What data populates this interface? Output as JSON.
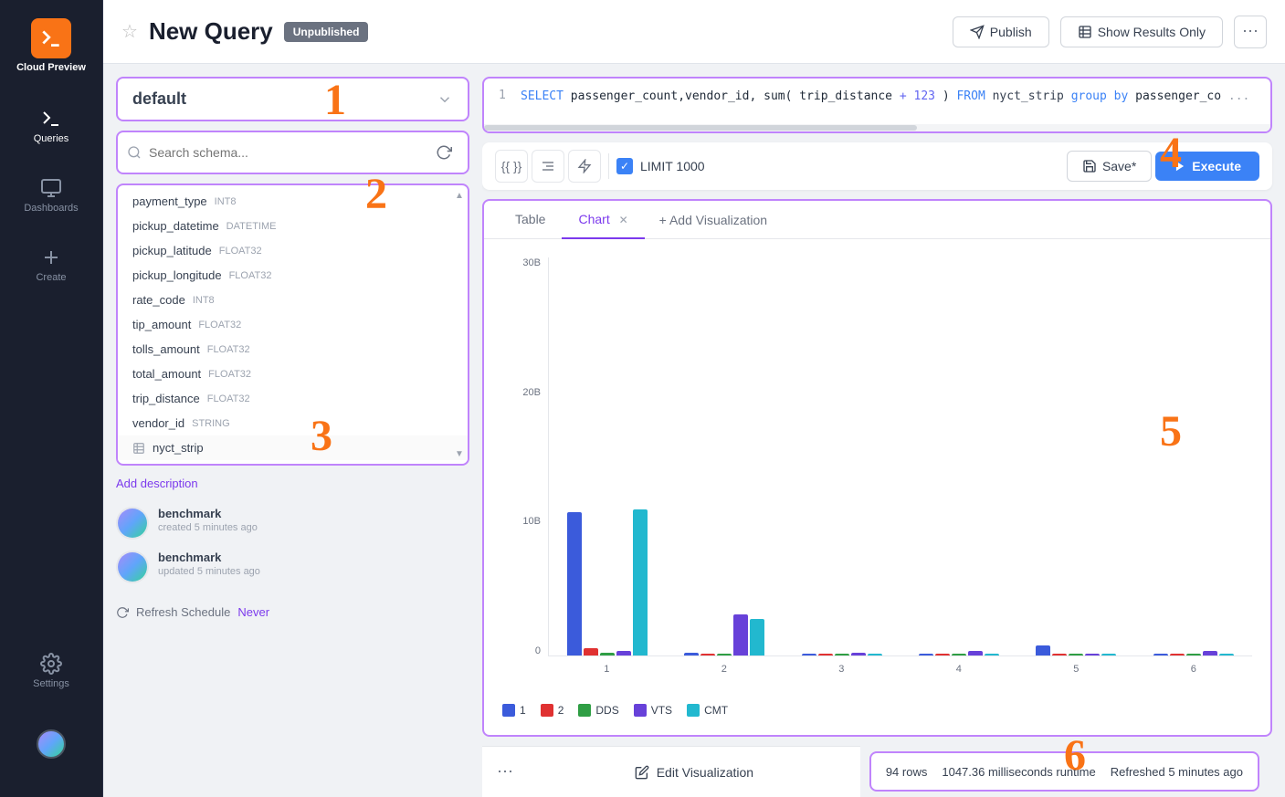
{
  "app": {
    "title": "Cloud Preview",
    "logo_icon": "terminal"
  },
  "sidebar": {
    "items": [
      {
        "label": "Queries",
        "icon": "terminal-icon",
        "active": true
      },
      {
        "label": "Dashboards",
        "icon": "monitor-icon",
        "active": false
      },
      {
        "label": "Create",
        "icon": "plus-icon",
        "active": false
      },
      {
        "label": "Settings",
        "icon": "gear-icon",
        "active": false
      }
    ]
  },
  "header": {
    "title": "New Query",
    "badge": "Unpublished",
    "publish_label": "Publish",
    "show_results_label": "Show Results Only",
    "more_icon": "ellipsis"
  },
  "schema": {
    "selected": "default",
    "search_placeholder": "Search schema...",
    "items": [
      {
        "name": "payment_type",
        "type": "INT8"
      },
      {
        "name": "pickup_datetime",
        "type": "DATETIME"
      },
      {
        "name": "pickup_latitude",
        "type": "FLOAT32"
      },
      {
        "name": "pickup_longitude",
        "type": "FLOAT32"
      },
      {
        "name": "rate_code",
        "type": "INT8"
      },
      {
        "name": "tip_amount",
        "type": "FLOAT32"
      },
      {
        "name": "tolls_amount",
        "type": "FLOAT32"
      },
      {
        "name": "total_amount",
        "type": "FLOAT32"
      },
      {
        "name": "trip_distance",
        "type": "FLOAT32"
      },
      {
        "name": "vendor_id",
        "type": "STRING"
      }
    ],
    "table": "nyct_strip",
    "add_desc_label": "Add description"
  },
  "query": {
    "line1": "SELECT passenger_count,vendor_id,sum(trip_distance+123) FROM nyct_strip group by passenger_co..."
  },
  "toolbar": {
    "template_label": "{{ }}",
    "indent_label": "indent",
    "lightning_label": "lightning",
    "limit_label": "LIMIT 1000",
    "limit_checked": true,
    "save_label": "Save*",
    "execute_label": "Execute"
  },
  "results": {
    "tabs": [
      {
        "label": "Table",
        "active": false,
        "closable": false
      },
      {
        "label": "Chart",
        "active": true,
        "closable": true
      }
    ],
    "add_viz_label": "+ Add Visualization",
    "chart": {
      "yaxis_labels": [
        "30B",
        "20B",
        "10B",
        "0"
      ],
      "xaxis_labels": [
        "1",
        "2",
        "3",
        "4",
        "5",
        "6"
      ],
      "groups": [
        {
          "x": "1",
          "bars": [
            {
              "color": "#3b5bdb",
              "height_pct": 98,
              "series": "1"
            },
            {
              "color": "#e03131",
              "height_pct": 5,
              "series": "2"
            },
            {
              "color": "#2f9e44",
              "height_pct": 2,
              "series": "DDS"
            },
            {
              "color": "#6741d9",
              "height_pct": 3,
              "series": "VTS"
            },
            {
              "color": "#22b8cf",
              "height_pct": 100,
              "series": "CMT"
            }
          ]
        },
        {
          "x": "2",
          "bars": [
            {
              "color": "#3b5bdb",
              "height_pct": 2,
              "series": "1"
            },
            {
              "color": "#e03131",
              "height_pct": 1,
              "series": "2"
            },
            {
              "color": "#2f9e44",
              "height_pct": 1,
              "series": "DDS"
            },
            {
              "color": "#6741d9",
              "height_pct": 28,
              "series": "VTS"
            },
            {
              "color": "#22b8cf",
              "height_pct": 25,
              "series": "CMT"
            }
          ]
        },
        {
          "x": "3",
          "bars": [
            {
              "color": "#3b5bdb",
              "height_pct": 1,
              "series": "1"
            },
            {
              "color": "#e03131",
              "height_pct": 0,
              "series": "2"
            },
            {
              "color": "#2f9e44",
              "height_pct": 1,
              "series": "DDS"
            },
            {
              "color": "#6741d9",
              "height_pct": 2,
              "series": "VTS"
            },
            {
              "color": "#22b8cf",
              "height_pct": 1,
              "series": "CMT"
            }
          ]
        },
        {
          "x": "4",
          "bars": [
            {
              "color": "#3b5bdb",
              "height_pct": 1,
              "series": "1"
            },
            {
              "color": "#e03131",
              "height_pct": 0,
              "series": "2"
            },
            {
              "color": "#2f9e44",
              "height_pct": 0,
              "series": "DDS"
            },
            {
              "color": "#6741d9",
              "height_pct": 3,
              "series": "VTS"
            },
            {
              "color": "#22b8cf",
              "height_pct": 1,
              "series": "CMT"
            }
          ]
        },
        {
          "x": "5",
          "bars": [
            {
              "color": "#3b5bdb",
              "height_pct": 7,
              "series": "1"
            },
            {
              "color": "#e03131",
              "height_pct": 0,
              "series": "2"
            },
            {
              "color": "#2f9e44",
              "height_pct": 0,
              "series": "DDS"
            },
            {
              "color": "#6741d9",
              "height_pct": 1,
              "series": "VTS"
            },
            {
              "color": "#22b8cf",
              "height_pct": 0,
              "series": "CMT"
            }
          ]
        },
        {
          "x": "6",
          "bars": [
            {
              "color": "#3b5bdb",
              "height_pct": 0,
              "series": "1"
            },
            {
              "color": "#e03131",
              "height_pct": 0,
              "series": "2"
            },
            {
              "color": "#2f9e44",
              "height_pct": 0,
              "series": "DDS"
            },
            {
              "color": "#6741d9",
              "height_pct": 3,
              "series": "VTS"
            },
            {
              "color": "#22b8cf",
              "height_pct": 0,
              "series": "CMT"
            }
          ]
        }
      ],
      "legend": [
        {
          "label": "1",
          "color": "#3b5bdb"
        },
        {
          "label": "2",
          "color": "#e03131"
        },
        {
          "label": "DDS",
          "color": "#2f9e44"
        },
        {
          "label": "VTS",
          "color": "#6741d9"
        },
        {
          "label": "CMT",
          "color": "#22b8cf"
        }
      ]
    }
  },
  "history": [
    {
      "name": "benchmark",
      "time": "created 5 minutes ago"
    },
    {
      "name": "benchmark",
      "time": "updated 5 minutes ago"
    }
  ],
  "footer": {
    "edit_viz_label": "Edit Visualization",
    "rows": "94 rows",
    "runtime": "1047.36 milliseconds runtime",
    "refreshed": "Refreshed 5 minutes ago"
  },
  "refresh": {
    "label": "Refresh Schedule",
    "value": "Never"
  },
  "numbers": {
    "n1": "1",
    "n2": "2",
    "n3": "3",
    "n4": "4",
    "n5": "5",
    "n6": "6"
  }
}
